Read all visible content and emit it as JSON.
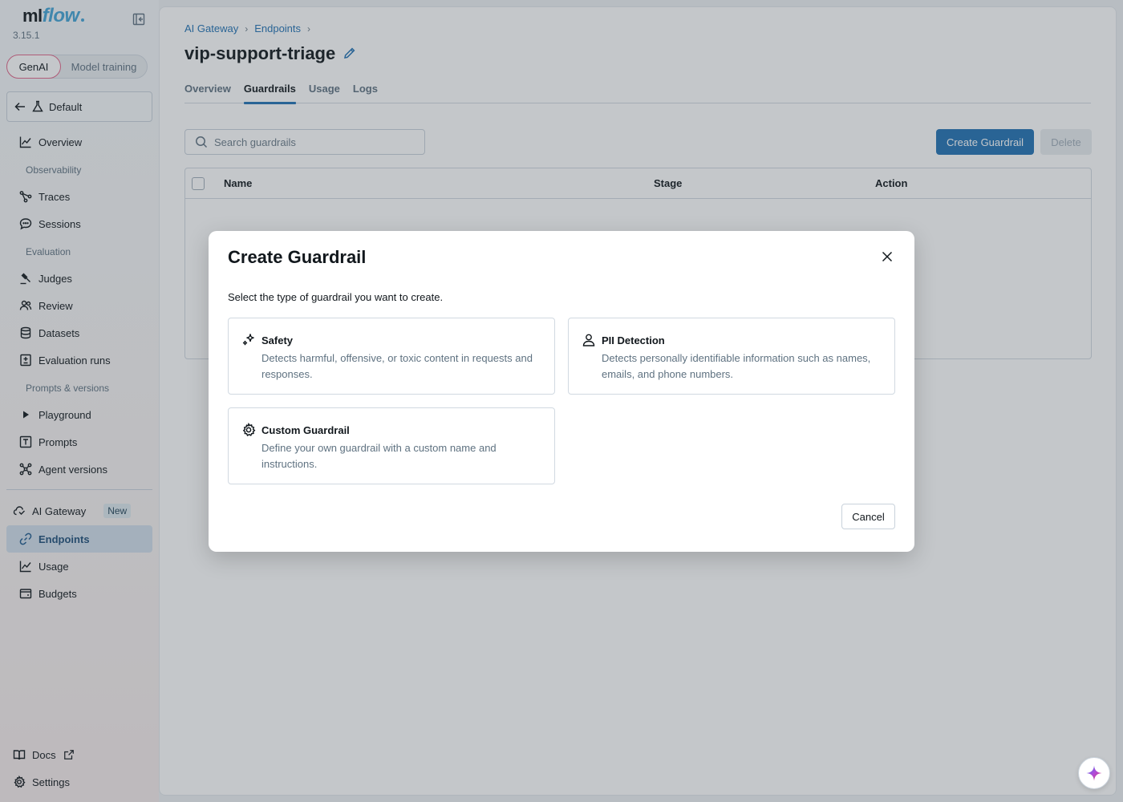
{
  "app": {
    "logo_ml": "ml",
    "logo_flow": "flow",
    "version": "3.15.1"
  },
  "mode_toggle": {
    "genai": "GenAI",
    "model_training": "Model training",
    "selected": "GenAI"
  },
  "workspace": {
    "label": "Default"
  },
  "sidebar": {
    "items": [
      {
        "label": "Overview",
        "icon": "chart-line-icon"
      },
      {
        "section": "Observability"
      },
      {
        "label": "Traces",
        "icon": "traces-icon"
      },
      {
        "label": "Sessions",
        "icon": "speech-bubble-icon"
      },
      {
        "section": "Evaluation"
      },
      {
        "label": "Judges",
        "icon": "gavel-icon"
      },
      {
        "label": "Review",
        "icon": "users-icon"
      },
      {
        "label": "Datasets",
        "icon": "database-icon"
      },
      {
        "label": "Evaluation runs",
        "icon": "evaluation-icon"
      },
      {
        "section": "Prompts & versions"
      },
      {
        "label": "Playground",
        "icon": "play-icon"
      },
      {
        "label": "Prompts",
        "icon": "text-box-icon"
      },
      {
        "label": "Agent versions",
        "icon": "models-icon"
      }
    ],
    "gateway": {
      "label": "AI Gateway",
      "badge": "New",
      "items": [
        {
          "label": "Endpoints",
          "icon": "link-icon",
          "active": true
        },
        {
          "label": "Usage",
          "icon": "chart-line-icon"
        },
        {
          "label": "Budgets",
          "icon": "wallet-icon"
        }
      ]
    },
    "footer": {
      "docs": "Docs",
      "settings": "Settings"
    }
  },
  "breadcrumb": [
    "AI Gateway",
    "Endpoints"
  ],
  "page": {
    "title": "vip-support-triage",
    "tabs": [
      "Overview",
      "Guardrails",
      "Usage",
      "Logs"
    ],
    "active_tab": "Guardrails",
    "search_placeholder": "Search guardrails",
    "create_button": "Create Guardrail",
    "delete_button": "Delete",
    "table_headers": [
      "Name",
      "Stage",
      "Action"
    ]
  },
  "modal": {
    "title": "Create Guardrail",
    "description": "Select the type of guardrail you want to create.",
    "options": [
      {
        "title": "Safety",
        "description": "Detects harmful, offensive, or toxic content in requests and responses.",
        "icon": "sparkle-icon"
      },
      {
        "title": "PII Detection",
        "description": "Detects personally identifiable information such as names, emails, and phone numbers.",
        "icon": "user-icon"
      },
      {
        "title": "Custom Guardrail",
        "description": "Define your own guardrail with a custom name and instructions.",
        "icon": "gear-icon"
      }
    ],
    "cancel": "Cancel"
  },
  "colors": {
    "primary": "#2272b4",
    "active_nav": "#d2dfeb",
    "genai_outline": "#e2668a"
  }
}
